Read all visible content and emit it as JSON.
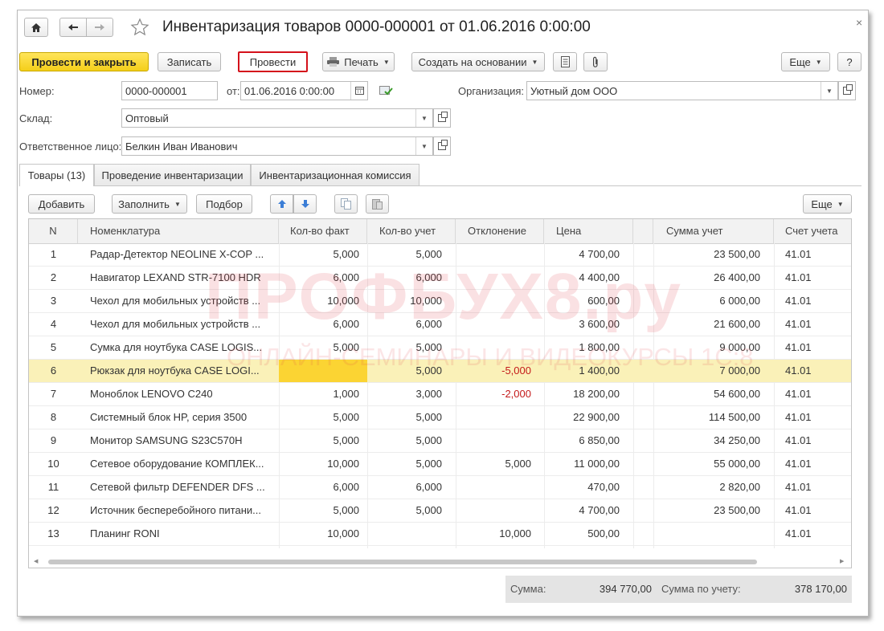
{
  "window": {
    "title": "Инвентаризация товаров 0000-000001 от 01.06.2016 0:00:00",
    "close_glyph": "×"
  },
  "toolbar": {
    "post_close": "Провести и закрыть",
    "save": "Записать",
    "post": "Провести",
    "print": "Печать",
    "create_based": "Создать на основании",
    "more": "Еще",
    "help": "?"
  },
  "form": {
    "number_label": "Номер:",
    "number_value": "0000-000001",
    "from_label": "от:",
    "date_value": "01.06.2016  0:00:00",
    "org_label": "Организация:",
    "org_value": "Уютный дом ООО",
    "warehouse_label": "Склад:",
    "warehouse_value": "Оптовый",
    "responsible_label": "Ответственное лицо:",
    "responsible_value": "Белкин Иван Иванович"
  },
  "tabs": [
    {
      "label": "Товары (13)"
    },
    {
      "label": "Проведение инвентаризации"
    },
    {
      "label": "Инвентаризационная комиссия"
    }
  ],
  "table_toolbar": {
    "add": "Добавить",
    "fill": "Заполнить",
    "pick": "Подбор",
    "more": "Еще"
  },
  "table": {
    "headers": [
      "N",
      "Номенклатура",
      "Кол-во факт",
      "Кол-во учет",
      "Отклонение",
      "Цена",
      "Сумма учет",
      "Счет учета"
    ],
    "rows": [
      [
        "1",
        "Радар-Детектор NEOLINE X-COP ...",
        "5,000",
        "5,000",
        "",
        "4 700,00",
        "23 500,00",
        "41.01"
      ],
      [
        "2",
        "Навигатор LEXAND STR-7100 HDR",
        "6,000",
        "6,000",
        "",
        "4 400,00",
        "26 400,00",
        "41.01"
      ],
      [
        "3",
        "Чехол для мобильных устройств  ...",
        "10,000",
        "10,000",
        "",
        "600,00",
        "6 000,00",
        "41.01"
      ],
      [
        "4",
        "Чехол для мобильных устройств ...",
        "6,000",
        "6,000",
        "",
        "3 600,00",
        "21 600,00",
        "41.01"
      ],
      [
        "5",
        "Сумка для ноутбука CASE LOGIS...",
        "5,000",
        "5,000",
        "",
        "1 800,00",
        "9 000,00",
        "41.01"
      ],
      [
        "6",
        "Рюкзак для ноутбука CASE LOGI...",
        "",
        "5,000",
        "-5,000",
        "1 400,00",
        "7 000,00",
        "41.01"
      ],
      [
        "7",
        "Моноблок  LENOVO C240",
        "1,000",
        "3,000",
        "-2,000",
        "18 200,00",
        "54 600,00",
        "41.01"
      ],
      [
        "8",
        "Системный блок HP, серия 3500",
        "5,000",
        "5,000",
        "",
        "22 900,00",
        "114 500,00",
        "41.01"
      ],
      [
        "9",
        "Монитор  SAMSUNG S23C570H",
        "5,000",
        "5,000",
        "",
        "6 850,00",
        "34 250,00",
        "41.01"
      ],
      [
        "10",
        "Сетевое оборудование КОМПЛЕК...",
        "10,000",
        "5,000",
        "5,000",
        "11 000,00",
        "55 000,00",
        "41.01"
      ],
      [
        "11",
        "Сетевой фильтр DEFENDER DFS ...",
        "6,000",
        "6,000",
        "",
        "470,00",
        "2 820,00",
        "41.01"
      ],
      [
        "12",
        "Источник бесперебойного  питани...",
        "5,000",
        "5,000",
        "",
        "4 700,00",
        "23 500,00",
        "41.01"
      ],
      [
        "13",
        "Планинг RONI",
        "10,000",
        "",
        "10,000",
        "500,00",
        "",
        "41.01"
      ]
    ]
  },
  "totals": {
    "sum_label": "Сумма:",
    "sum_value": "394 770,00",
    "acc_label": "Сумма по учету:",
    "acc_value": "378 170,00"
  },
  "watermark": {
    "line1": "ПРОФБУХ8.ру",
    "line2": "ОНЛАЙН-СЕМИНАРЫ И ВИДЕОКУРСЫ 1С:8"
  },
  "colors": {
    "accent_yellow": "#f4cf1a",
    "selected_row": "#faf1b8",
    "negative": "#c41a1a",
    "post_frame": "#d4111b"
  }
}
